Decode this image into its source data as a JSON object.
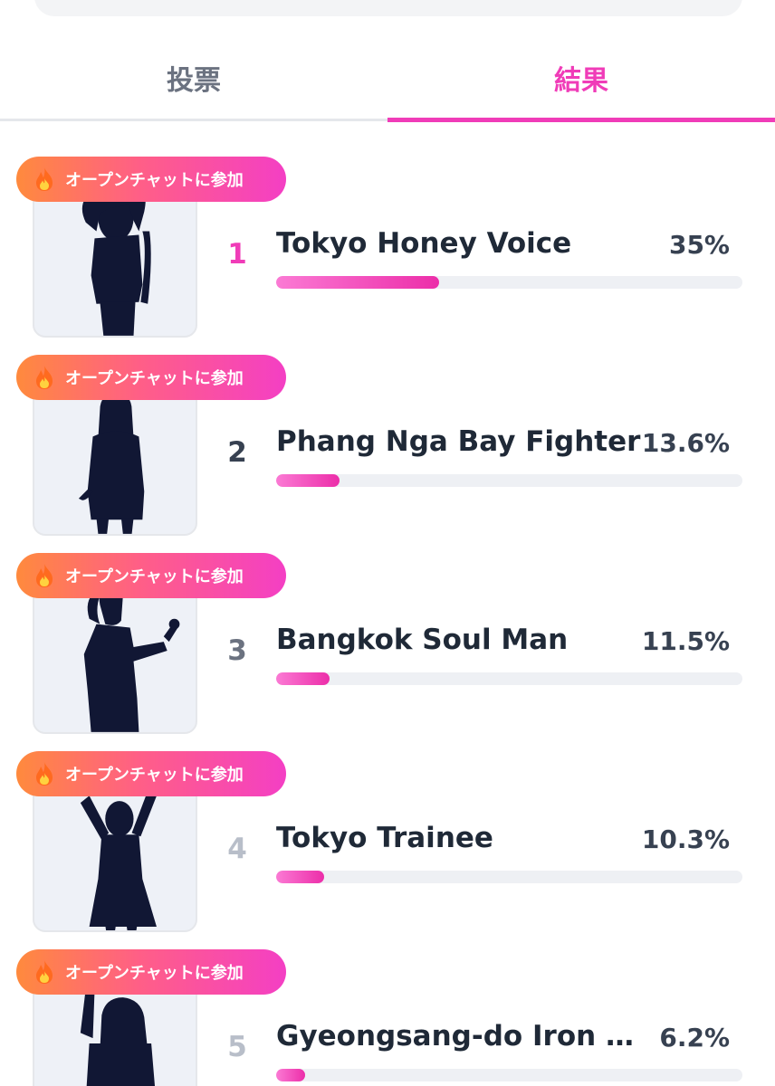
{
  "tabs": {
    "vote_label": "投票",
    "result_label": "結果",
    "active": "result"
  },
  "chat_badge_label": "オープンチャットに参加",
  "colors": {
    "accent": "#f03cb8",
    "rank_top": "#f03cb8",
    "rank_second": "#374151",
    "rank_third": "#6b7280",
    "rank_rest": "#b8bec9"
  },
  "entries": [
    {
      "rank": "1",
      "name": "Tokyo Honey Voice",
      "percent_label": "35%",
      "percent": 35,
      "image": "silhouette-heart-hands"
    },
    {
      "rank": "2",
      "name": "Phang Nga Bay Fighter",
      "percent_label": "13.6%",
      "percent": 13.6,
      "image": "silhouette-standing"
    },
    {
      "rank": "3",
      "name": "Bangkok Soul Man",
      "percent_label": "11.5%",
      "percent": 11.5,
      "image": "silhouette-microphone"
    },
    {
      "rank": "4",
      "name": "Tokyo Trainee",
      "percent_label": "10.3%",
      "percent": 10.3,
      "image": "silhouette-arms-up"
    },
    {
      "rank": "5",
      "name": "Gyeongsang-do Iron Th...",
      "percent_label": "6.2%",
      "percent": 6.2,
      "image": "silhouette-arm-raised"
    }
  ]
}
